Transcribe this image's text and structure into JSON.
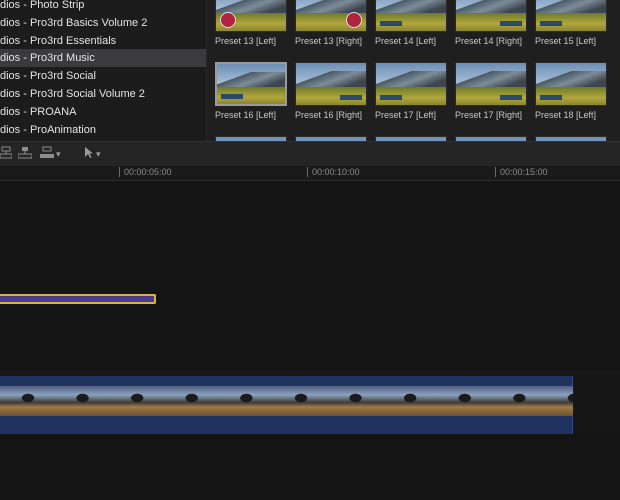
{
  "browser": {
    "categories": [
      {
        "label": "dios - Photo Strip",
        "selected": false
      },
      {
        "label": "dios - Pro3rd Basics Volume 2",
        "selected": false
      },
      {
        "label": "dios - Pro3rd Essentials",
        "selected": false
      },
      {
        "label": "dios - Pro3rd Music",
        "selected": true
      },
      {
        "label": "dios - Pro3rd Social",
        "selected": false
      },
      {
        "label": "dios - Pro3rd Social Volume 2",
        "selected": false
      },
      {
        "label": "dios - PROANA",
        "selected": false
      },
      {
        "label": "dios - ProAnimation",
        "selected": false
      }
    ],
    "presets": [
      {
        "label": "Preset 13 [Left]",
        "accent": "badge-left"
      },
      {
        "label": "Preset 13 [Right]",
        "accent": "badge-right"
      },
      {
        "label": "Preset 14 [Left]",
        "accent": "tag-left"
      },
      {
        "label": "Preset 14 [Right]",
        "accent": "tag-right"
      },
      {
        "label": "Preset 15 [Left]",
        "accent": "tag-left"
      },
      {
        "label": "Preset 16 [Left]",
        "accent": "tag-left",
        "selected": true
      },
      {
        "label": "Preset 16 [Right]",
        "accent": "tag-right"
      },
      {
        "label": "Preset 17 [Left]",
        "accent": "tag-left"
      },
      {
        "label": "Preset 17 [Right]",
        "accent": "tag-right"
      },
      {
        "label": "Preset 18 [Left]",
        "accent": "tag-left"
      }
    ]
  },
  "toolbar": {
    "icons": [
      "connect-clip-icon",
      "insert-clip-icon",
      "overwrite-clip-icon",
      "select-tool-icon"
    ]
  },
  "ruler": {
    "labels": [
      "00:00:05:00",
      "00:00:10:00",
      "00:00:15:00"
    ]
  },
  "colors": {
    "title_clip": "#4a3b8c",
    "title_clip_border": "#d8b43a",
    "video_clip": "#1f3260",
    "selection": "#3b3b3d"
  }
}
